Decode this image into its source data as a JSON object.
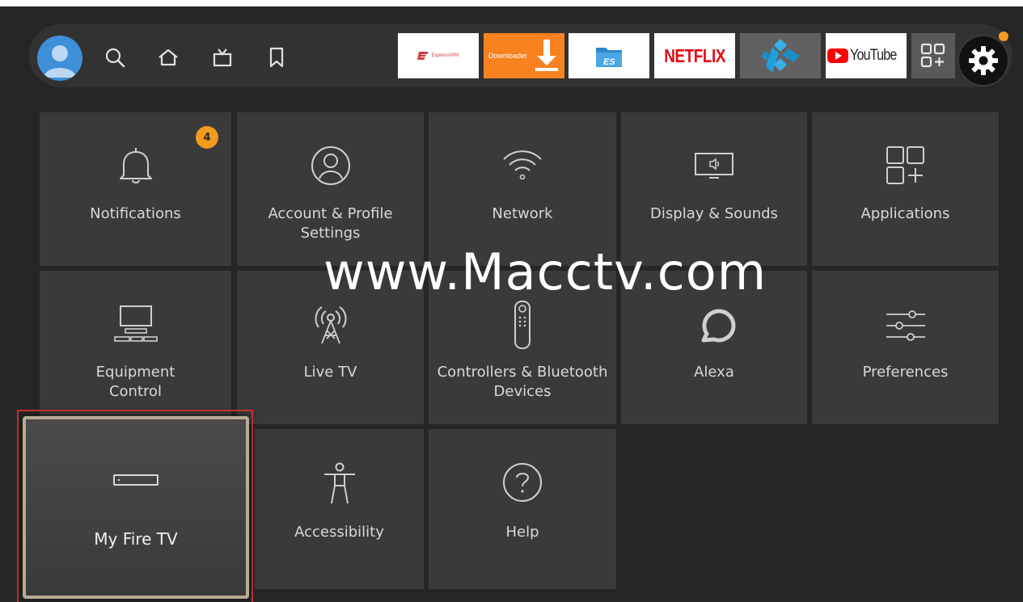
{
  "nav": {
    "avatar": "user-avatar",
    "icons": [
      "search-icon",
      "home-icon",
      "live-tv-icon",
      "bookmark-icon"
    ],
    "apps": {
      "expressvpn": "ExpressVPN",
      "downloader": "Downloader",
      "es_file": "ES",
      "netflix": "NETFLIX",
      "kodi": "kodi-icon",
      "youtube": "YouTube"
    },
    "settings_icon": "gear-icon",
    "colors": {
      "downloader": "#f7821f",
      "netflix": "#e50914",
      "youtube": "#ff0000",
      "badge": "#f39a1f"
    }
  },
  "tiles": {
    "notifications": {
      "label": "Notifications",
      "badge": "4"
    },
    "account": {
      "label": "Account & Profile Settings"
    },
    "network": {
      "label": "Network"
    },
    "display": {
      "label": "Display & Sounds"
    },
    "applications": {
      "label": "Applications"
    },
    "equipment": {
      "label": "Equipment Control"
    },
    "livetv": {
      "label": "Live TV"
    },
    "controllers": {
      "label": "Controllers & Bluetooth Devices"
    },
    "alexa": {
      "label": "Alexa"
    },
    "preferences": {
      "label": "Preferences"
    },
    "myfiretv": {
      "label": "My Fire TV"
    },
    "accessibility": {
      "label": "Accessibility"
    },
    "help": {
      "label": "Help"
    }
  },
  "watermark": "www.Macctv.com"
}
